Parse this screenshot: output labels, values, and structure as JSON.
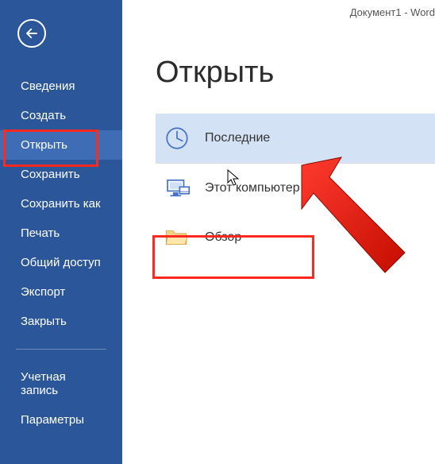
{
  "titlebar": "Документ1 - Word",
  "page_title": "Открыть",
  "sidebar": {
    "items": [
      {
        "label": "Сведения"
      },
      {
        "label": "Создать"
      },
      {
        "label": "Открыть"
      },
      {
        "label": "Сохранить"
      },
      {
        "label": "Сохранить как"
      },
      {
        "label": "Печать"
      },
      {
        "label": "Общий доступ"
      },
      {
        "label": "Экспорт"
      },
      {
        "label": "Закрыть"
      }
    ],
    "bottom_items": [
      {
        "label": "Учетная запись"
      },
      {
        "label": "Параметры"
      }
    ],
    "selected_index": 2
  },
  "open_panel": {
    "options": [
      {
        "label": "Последние",
        "icon": "clock-icon"
      },
      {
        "label": "Этот компьютер",
        "icon": "pc-icon"
      },
      {
        "label": "Обзор",
        "icon": "folder-icon"
      }
    ],
    "selected_index": 0
  },
  "annotations": {
    "highlight_sidebar_index": 2,
    "highlight_option_index": 2,
    "arrow_points_to_option_index": 0
  }
}
